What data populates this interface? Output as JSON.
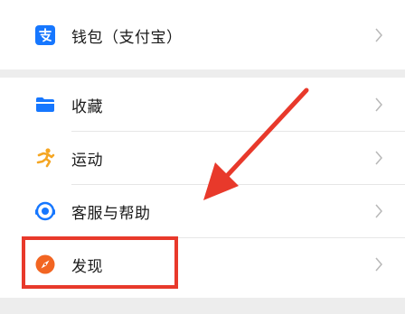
{
  "menu": {
    "items": [
      {
        "key": "wallet",
        "label": "钱包（支付宝）",
        "icon": "alipay-icon"
      },
      {
        "key": "favorites",
        "label": "收藏",
        "icon": "folder-icon"
      },
      {
        "key": "sports",
        "label": "运动",
        "icon": "running-person-icon"
      },
      {
        "key": "support",
        "label": "客服与帮助",
        "icon": "headset-icon"
      },
      {
        "key": "discover",
        "label": "发现",
        "icon": "compass-icon"
      }
    ]
  },
  "annotation": {
    "highlighted_item": "discover",
    "color": "#e8392b"
  },
  "colors": {
    "alipay": "#1677ff",
    "favorites": "#1677ff",
    "sports": "#f5a623",
    "support": "#1677ff",
    "discover": "#f26522"
  }
}
